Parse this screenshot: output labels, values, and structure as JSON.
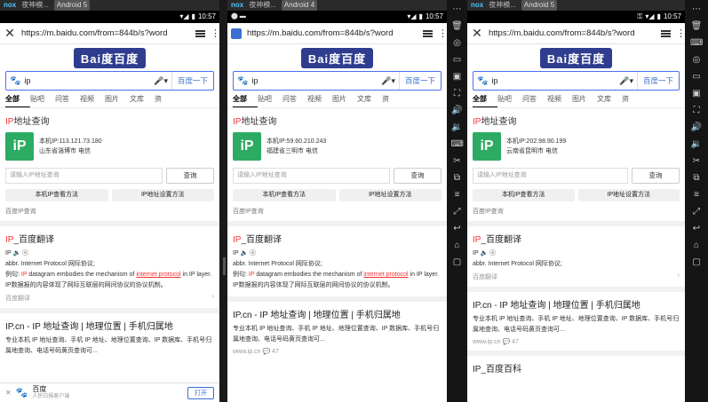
{
  "emulator": {
    "brand": "nox",
    "title": "夜神模...",
    "instances": [
      "Android 5",
      "Android 4",
      "Android 5"
    ]
  },
  "status": {
    "time": "10:57"
  },
  "browser": {
    "url": "https://m.baidu.com/from=844b/s?word",
    "logo": "Bai度百度"
  },
  "search": {
    "query": "ip",
    "submit_label": "百度一下"
  },
  "tabs": [
    "全部",
    "贴吧",
    "问答",
    "视频",
    "图片",
    "文库",
    "资"
  ],
  "ip_card": {
    "title_prefix": "IP",
    "title_suffix": "地址查询",
    "logo_text": "iP",
    "input_placeholder": "请输入IP地址查询",
    "query_button": "查询",
    "btn_local_method": "本机IP查看方法",
    "btn_setting_method": "IP地址设置方法",
    "source": "百度IP查询"
  },
  "panels": [
    {
      "local_ip": "本机IP:113.121.73.180",
      "location": "山东省淄博市 电信"
    },
    {
      "local_ip": "本机IP:59.60.210.243",
      "location": "福建省三明市 电信"
    },
    {
      "local_ip": "本机IP:202.98.90.199",
      "location": "云南省昆明市 电信"
    }
  ],
  "translate": {
    "title_red": "IP",
    "title_rest": "_百度翻译",
    "word": "IP",
    "abbr": "abbr.  Internet Protocol 网际协议;",
    "example_label": "例句:",
    "example_en_1": "IP",
    "example_en_2": "datagram embodies the mechanism of",
    "example_en_3": "internet protocol",
    "example_en_4": "in IP layer.",
    "example_cn": "IP数据报的内容体现了网际互联层的网间协议的协议机制。",
    "source": "百度翻译"
  },
  "ipcn": {
    "title": "IP.cn - IP 地址查询 | 地理位置 | 手机归属地",
    "desc": "专业本机 IP 地址查询、手机 IP 地址、地理位置查询、IP 数据库、手机号归属地查询、电话号码黄页查询可...",
    "site": "www.ip.cn",
    "comments": "47"
  },
  "baike": {
    "title": "IP_百度百科"
  },
  "ad": {
    "name": "百度",
    "sub": "人民日报客户端",
    "open": "打开"
  }
}
